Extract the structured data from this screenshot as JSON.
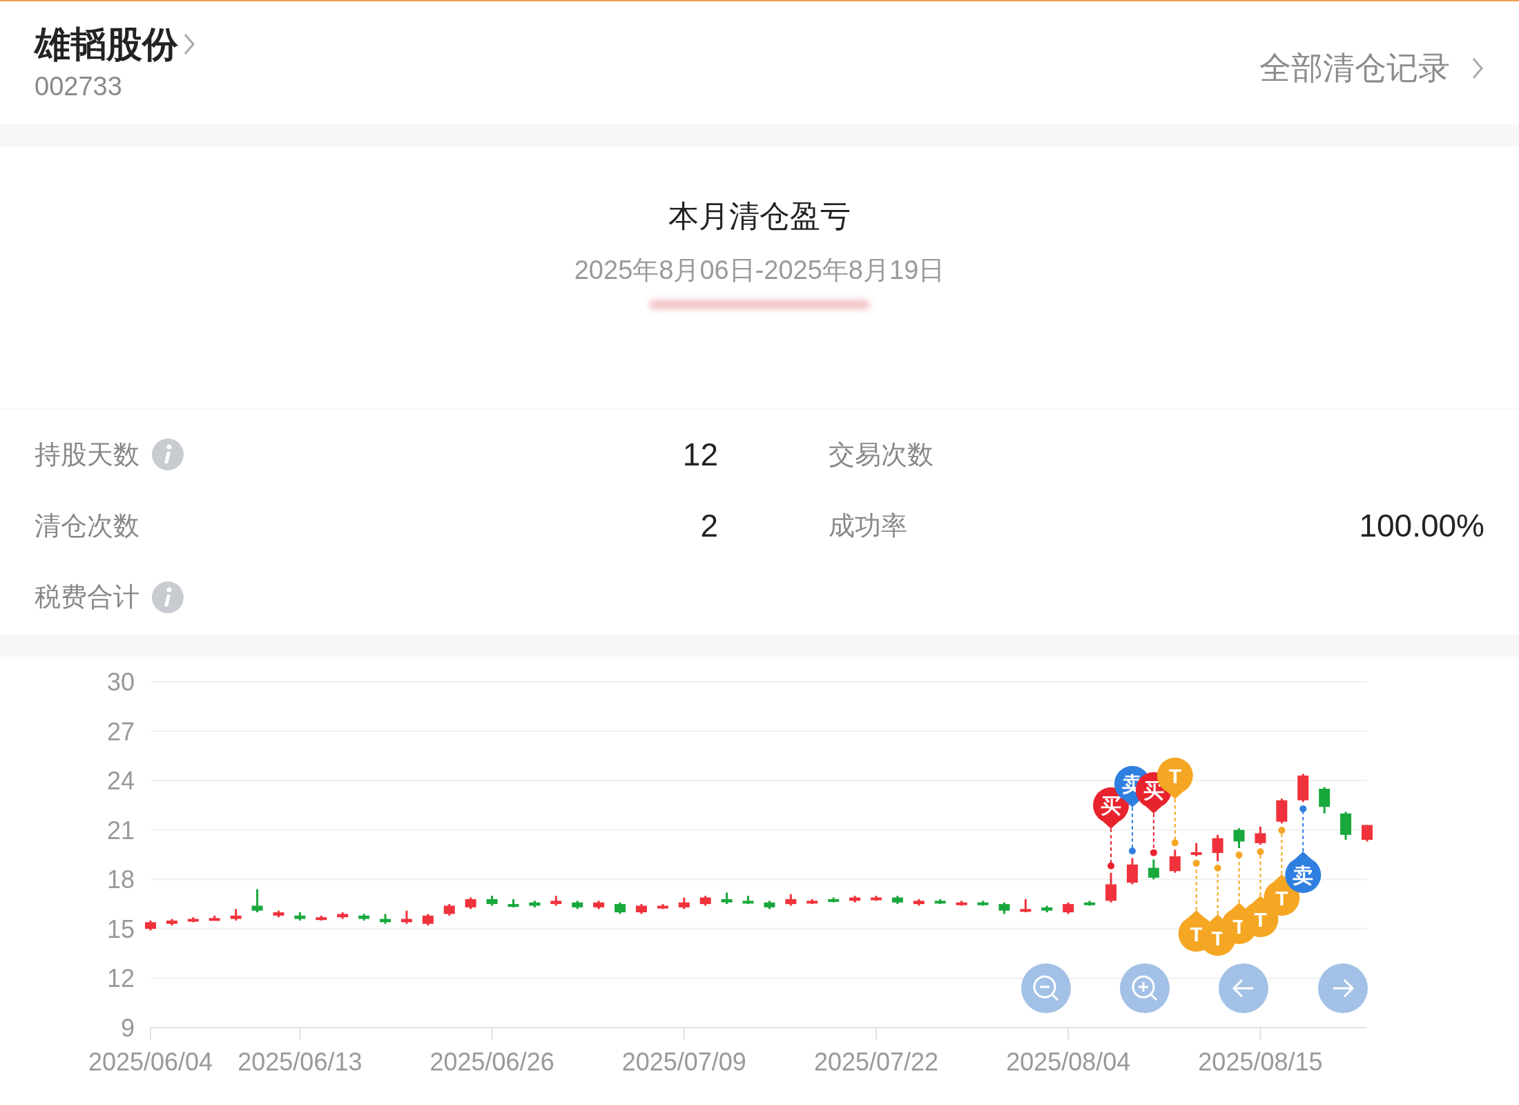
{
  "header": {
    "stock_name": "雄韬股份",
    "stock_code": "002733",
    "link": "全部清仓记录"
  },
  "summary": {
    "title": "本月清仓盈亏",
    "period": "2025年8月06日-2025年8月19日"
  },
  "stats": [
    {
      "label": "持股天数",
      "info": true,
      "value": "12"
    },
    {
      "label": "交易次数",
      "info": false
    },
    {
      "label": "清仓次数",
      "info": false,
      "value": "2"
    },
    {
      "label": "成功率",
      "info": false,
      "value": "100.00%"
    },
    {
      "label": "税费合计",
      "info": true
    }
  ],
  "chart": {
    "chart_data": {
      "type": "candlestick",
      "ylim": [
        9,
        30
      ],
      "grid": true,
      "yticks": [
        9,
        12,
        15,
        18,
        21,
        24,
        27,
        30
      ],
      "categories": [
        "2025/06/04",
        null,
        null,
        null,
        null,
        null,
        null,
        "2025/06/13",
        null,
        null,
        null,
        null,
        null,
        null,
        null,
        null,
        "2025/06/26",
        null,
        null,
        null,
        null,
        null,
        null,
        null,
        null,
        "2025/07/09",
        null,
        null,
        null,
        null,
        null,
        null,
        null,
        null,
        "2025/07/22",
        null,
        null,
        null,
        null,
        null,
        null,
        null,
        null,
        "2025/08/04",
        null,
        null,
        null,
        null,
        null,
        null,
        null,
        null,
        "2025/08/15",
        null,
        null,
        null,
        null,
        null
      ],
      "ohlc": [
        [
          15.0,
          15.5,
          14.9,
          15.4
        ],
        [
          15.3,
          15.6,
          15.2,
          15.5
        ],
        [
          15.5,
          15.7,
          15.4,
          15.6
        ],
        [
          15.55,
          15.8,
          15.5,
          15.65
        ],
        [
          15.6,
          16.2,
          15.5,
          15.8
        ],
        [
          16.4,
          17.4,
          16.0,
          16.1
        ],
        [
          15.8,
          16.1,
          15.7,
          16.0
        ],
        [
          15.8,
          16.0,
          15.5,
          15.6
        ],
        [
          15.6,
          15.8,
          15.5,
          15.7
        ],
        [
          15.7,
          16.0,
          15.6,
          15.9
        ],
        [
          15.8,
          15.9,
          15.5,
          15.6
        ],
        [
          15.6,
          15.9,
          15.3,
          15.4
        ],
        [
          15.4,
          16.1,
          15.3,
          15.6
        ],
        [
          15.3,
          15.9,
          15.2,
          15.8
        ],
        [
          15.9,
          16.5,
          15.8,
          16.4
        ],
        [
          16.3,
          16.9,
          16.2,
          16.8
        ],
        [
          16.8,
          17.0,
          16.4,
          16.5
        ],
        [
          16.5,
          16.8,
          16.3,
          16.4
        ],
        [
          16.6,
          16.7,
          16.3,
          16.4
        ],
        [
          16.5,
          17.0,
          16.4,
          16.7
        ],
        [
          16.6,
          16.7,
          16.2,
          16.3
        ],
        [
          16.3,
          16.7,
          16.2,
          16.6
        ],
        [
          16.5,
          16.6,
          15.9,
          16.0
        ],
        [
          16.0,
          16.5,
          15.9,
          16.4
        ],
        [
          16.3,
          16.5,
          16.2,
          16.4
        ],
        [
          16.3,
          16.9,
          16.2,
          16.6
        ],
        [
          16.5,
          17.0,
          16.4,
          16.9
        ],
        [
          16.8,
          17.2,
          16.5,
          16.6
        ],
        [
          16.7,
          17.0,
          16.5,
          16.6
        ],
        [
          16.6,
          16.7,
          16.2,
          16.3
        ],
        [
          16.5,
          17.1,
          16.4,
          16.8
        ],
        [
          16.6,
          16.8,
          16.5,
          16.7
        ],
        [
          16.8,
          16.9,
          16.6,
          16.7
        ],
        [
          16.7,
          17.0,
          16.6,
          16.9
        ],
        [
          16.8,
          17.0,
          16.7,
          16.9
        ],
        [
          16.9,
          17.0,
          16.5,
          16.6
        ],
        [
          16.5,
          16.8,
          16.4,
          16.7
        ],
        [
          16.7,
          16.8,
          16.5,
          16.6
        ],
        [
          16.5,
          16.7,
          16.4,
          16.6
        ],
        [
          16.6,
          16.7,
          16.4,
          16.5
        ],
        [
          16.5,
          16.6,
          15.9,
          16.1
        ],
        [
          16.1,
          16.8,
          16.0,
          16.2
        ],
        [
          16.3,
          16.4,
          16.0,
          16.1
        ],
        [
          16.0,
          16.6,
          15.9,
          16.5
        ],
        [
          16.6,
          16.7,
          16.4,
          16.5
        ],
        [
          16.7,
          18.4,
          16.6,
          17.7
        ],
        [
          17.8,
          19.3,
          17.7,
          18.9
        ],
        [
          18.7,
          19.2,
          18.0,
          18.1
        ],
        [
          18.5,
          19.8,
          18.4,
          19.4
        ],
        [
          19.5,
          20.2,
          19.4,
          19.65
        ],
        [
          19.6,
          20.7,
          19.1,
          20.5
        ],
        [
          21.0,
          21.1,
          19.9,
          20.3
        ],
        [
          20.2,
          21.2,
          20.1,
          20.8
        ],
        [
          21.5,
          22.9,
          21.4,
          22.8
        ],
        [
          22.8,
          24.4,
          22.7,
          24.3
        ],
        [
          23.5,
          23.6,
          22.0,
          22.4
        ],
        [
          22.0,
          22.1,
          20.4,
          20.7
        ],
        [
          20.4,
          21.3,
          20.3,
          21.3
        ]
      ]
    },
    "markers": [
      {
        "kind": "buy",
        "label": "买"
      },
      {
        "kind": "sell",
        "label": "卖"
      },
      {
        "kind": "buy",
        "label": "买"
      },
      {
        "kind": "t",
        "label": "T"
      },
      {
        "kind": "t",
        "label": "T"
      },
      {
        "kind": "t",
        "label": "T"
      },
      {
        "kind": "t",
        "label": "T"
      },
      {
        "kind": "t",
        "label": "T"
      },
      {
        "kind": "t",
        "label": "T"
      },
      {
        "kind": "sell",
        "label": "卖"
      }
    ],
    "controls": [
      {
        "kind": "zoom_out"
      },
      {
        "kind": "zoom_in"
      },
      {
        "kind": "back"
      },
      {
        "kind": "forward"
      }
    ]
  }
}
